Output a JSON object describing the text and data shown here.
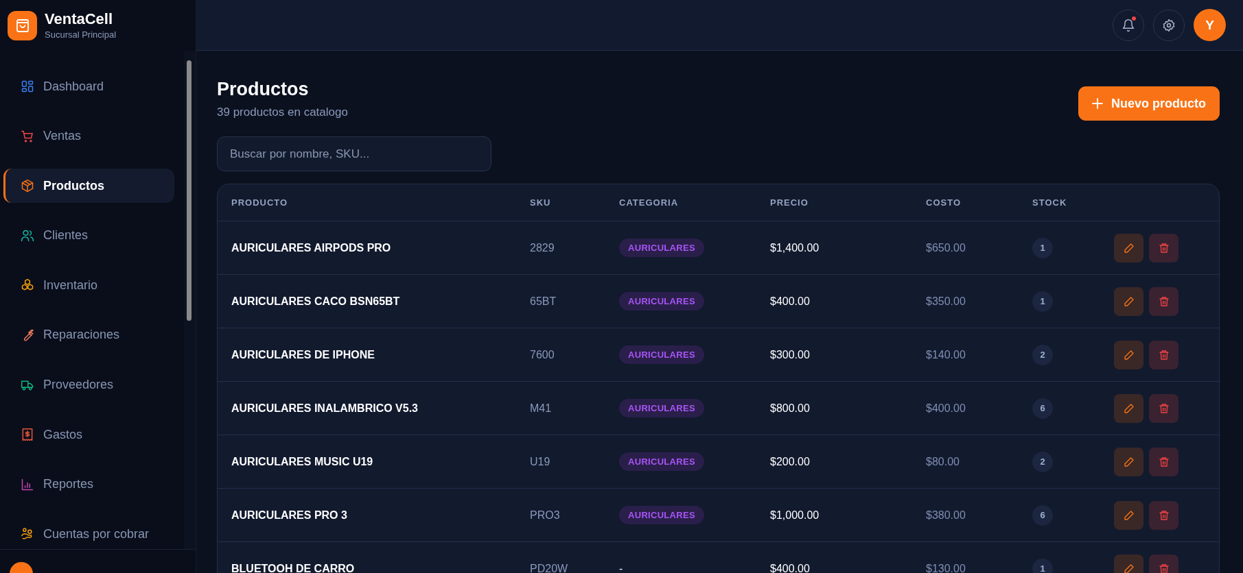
{
  "brand": {
    "name": "VentaCell",
    "subtitle": "Sucursal Principal"
  },
  "nav": [
    {
      "label": "Dashboard",
      "color": "#3b82f6",
      "selected": false
    },
    {
      "label": "Ventas",
      "color": "#ef4444",
      "selected": false
    },
    {
      "label": "Productos",
      "color": "#f97316",
      "selected": true
    },
    {
      "label": "Clientes",
      "color": "#14b8a6",
      "selected": false
    },
    {
      "label": "Inventario",
      "color": "#f59e0b",
      "selected": false
    },
    {
      "label": "Reparaciones",
      "color": "#ec7a5c",
      "selected": false
    },
    {
      "label": "Proveedores",
      "color": "#10b981",
      "selected": false
    },
    {
      "label": "Gastos",
      "color": "#e4533d",
      "selected": false
    },
    {
      "label": "Reportes",
      "color": "#c044b4",
      "selected": false
    },
    {
      "label": "Cuentas por cobrar",
      "color": "#f59e0b",
      "selected": false
    }
  ],
  "header": {
    "unread_notifications": true,
    "avatar": "Y"
  },
  "page": {
    "title": "Productos",
    "subtitle": "39 productos en catalogo",
    "new_button": "Nuevo producto",
    "search": {
      "placeholder": "Buscar por nombre, SKU..."
    }
  },
  "table": {
    "columns": [
      "PRODUCTO",
      "SKU",
      "CATEGORIA",
      "PRECIO",
      "COSTO",
      "STOCK"
    ],
    "rows": [
      {
        "name": "AURICULARES AIRPODS PRO",
        "sku": "2829",
        "category": {
          "label": "AURICULARES",
          "kind": "badge"
        },
        "price": "$1,400.00",
        "cost": "$650.00",
        "stock": "1"
      },
      {
        "name": "AURICULARES CACO BSN65BT",
        "sku": "65BT",
        "category": {
          "label": "AURICULARES",
          "kind": "badge"
        },
        "price": "$400.00",
        "cost": "$350.00",
        "stock": "1"
      },
      {
        "name": "AURICULARES DE IPHONE",
        "sku": "7600",
        "category": {
          "label": "AURICULARES",
          "kind": "badge"
        },
        "price": "$300.00",
        "cost": "$140.00",
        "stock": "2"
      },
      {
        "name": "AURICULARES INALAMBRICO V5.3",
        "sku": "M41",
        "category": {
          "label": "AURICULARES",
          "kind": "badge"
        },
        "price": "$800.00",
        "cost": "$400.00",
        "stock": "6"
      },
      {
        "name": "AURICULARES MUSIC U19",
        "sku": "U19",
        "category": {
          "label": "AURICULARES",
          "kind": "badge"
        },
        "price": "$200.00",
        "cost": "$80.00",
        "stock": "2"
      },
      {
        "name": "AURICULARES PRO 3",
        "sku": "PRO3",
        "category": {
          "label": "AURICULARES",
          "kind": "badge"
        },
        "price": "$1,000.00",
        "cost": "$380.00",
        "stock": "6"
      },
      {
        "name": "BLUETOOH DE CARRO",
        "sku": "PD20W",
        "category": {
          "label": "-",
          "kind": "plain"
        },
        "price": "$400.00",
        "cost": "$130.00",
        "stock": "1"
      }
    ]
  }
}
